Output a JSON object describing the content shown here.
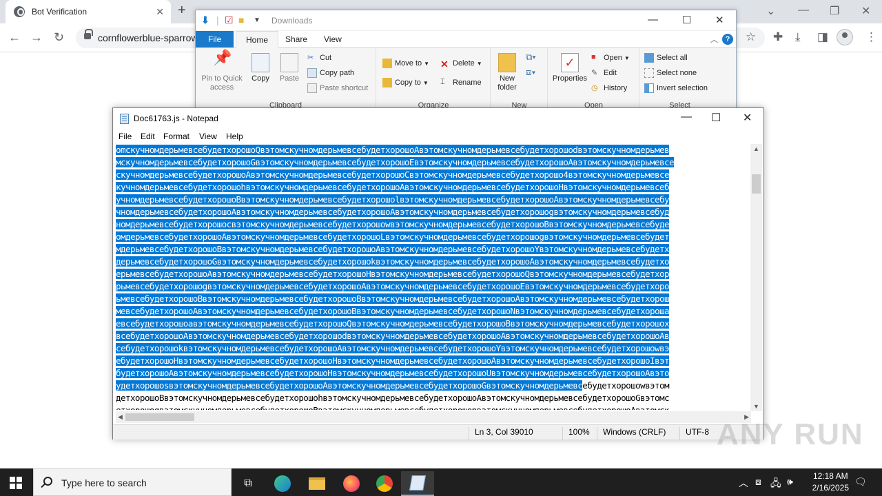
{
  "browser": {
    "tab_title": "Bot Verification",
    "url": "cornflowerblue-sparrow",
    "tab_close": "✕",
    "new_tab": "+"
  },
  "explorer": {
    "title": "Downloads",
    "tabs": [
      "File",
      "Home",
      "Share",
      "View"
    ],
    "clipboard": {
      "pin": "Pin to Quick access",
      "copy": "Copy",
      "paste": "Paste",
      "cut": "Cut",
      "copy_path": "Copy path",
      "paste_shortcut": "Paste shortcut",
      "label": "Clipboard"
    },
    "organize": {
      "move_to": "Move to",
      "copy_to": "Copy to",
      "delete": "Delete",
      "rename": "Rename",
      "label": "Organize"
    },
    "new": {
      "new_folder": "New folder",
      "label": "New"
    },
    "open": {
      "properties": "Properties",
      "open": "Open",
      "edit": "Edit",
      "history": "History",
      "label": "Open"
    },
    "select": {
      "select_all": "Select all",
      "select_none": "Select none",
      "invert": "Invert selection",
      "label": "Select"
    }
  },
  "notepad": {
    "title": "Doc61763.js - Notepad",
    "menu": [
      "File",
      "Edit",
      "Format",
      "View",
      "Help"
    ],
    "lines_selected": [
      "omскучномдерьмевсебудетхорошоQвэтомскучномдерьмевсебудетхорошоAвэтомскучномдерьмевсебудетхорошоdвэтомскучномдерьмев",
      "мскучномдерьмевсебудетхорошоGвэтомскучномдерьмевсебудетхорошоEвэтомскучномдерьмевсебудетхорошоAвэтомскучномдерьмевсе",
      "скучномдерьмевсебудетхорошоAвэтомскучномдерьмевсебудетхорошоCвэтомскучномдерьмевсебудетхорошо4вэтомскучномдерьмевсе",
      "кучномдерьмевсебудетхорошоhвэтомскучномдерьмевсебудетхорошоAвэтомскучномдерьмевсебудетхорошоHвэтомскучномдерьмевсеб",
      "учномдерьмевсебудетхорошоBвэтомскучномдерьмевсебудетхорошоlвэтомскучномдерьмевсебудетхорошоAвэтомскучномдерьмевсебу",
      "чномдерьмевсебудетхорошоAвэтомскучномдерьмевсебудетхорошоAвэтомскучномдерьмевсебудетхорошоgвэтомскучномдерьмевсебуд",
      "номдерьмевсебудетхорошоcвэтомскучномдерьмевсебудетхорошоwвэтомскучномдерьмевсебудетхорошоBвэтомскучномдерьмевсебуде",
      "омдерьмевсебудетхорошоAвэтомскучномдерьмевсебудетхорошоLвэтомскучномдерьмевсебудетхорошоgвэтомскучномдерьмевсебудет",
      "мдерьмевсебудетхорошоBвэтомскучномдерьмевсебудетхорошоAвэтомскучномдерьмевсебудетхорошоYвэтомскучномдерьмевсебудетх",
      "дерьмевсебудетхорошоGвэтомскучномдерьмевсебудетхорошоkвэтомскучномдерьмевсебудетхорошоAвэтомскучномдерьмевсебудетхо",
      "ерьмевсебудетхорошоAвэтомскучномдерьмевсебудетхорошоHвэтомскучномдерьмевсебудетхорошоQвэтомскучномдерьмевсебудетхор",
      "рьмевсебудетхорошоgвэтомскучномдерьмевсебудетхорошоAвэтомскучномдерьмевсебудетхорошоEвэтомскучномдерьмевсебудетхоро",
      "ьмевсебудетхорошоBвэтомскучномдерьмевсебудетхорошоBвэтомскучномдерьмевсебудетхорошоAвэтомскучномдерьмевсебудетхорош",
      "мевсебудетхорошоAвэтомскучномдерьмевсебудетхорошоBвэтомскучномдерьмевсебудетхорошоNвэтомскучномдерьмевсебудетхороша",
      "евсебудетхорошоaвэтомскучномдерьмевсебудетхорошоQвэтомскучномдерьмевсебудетхорошоBвэтомскучномдерьмевсебудетхорошоx",
      "всебудетхорошоAвэтомскучномдерьмевсебудетхорошоdвэтомскучномдерьмевсебудетхорошоAвэтомскучномдерьмевсебудетхорошоAв",
      "себудетхорошоkвэтомскучномдерьмевсебудетхорошоAвэтомскучномдерьмевсебудетхорошоYвэтомскучномдерьмевсебудетхорошоwвэ",
      "ебудетхорошоHвэтомскучномдерьмевсебудетхорошоHвэтомскучномдерьмевсебудетхорошоAвэтомскучномдерьмевсебудетхорошоIвэт",
      "будетхорошоAвэтомскучномдерьмевсебудетхорошоHвэтомскучномдерьмевсебудетхорошоUвэтомскучномдерьмевсебудетхорошоAвэто"
    ],
    "last_line_selected": "удетхорошоsвэтомскучномдерьмевсебудетхорошоAвэтомскучномдерьмевсебудетхорошоGвэтомскучномдерьмевс",
    "last_line_rest": "ебудетхорошоwвэтом",
    "lines_plain": [
      "детхорошоBвэтомскучномдерьмевсебудетхорошоhвэтомскучномдерьмевсебудетхорошоAвэтомскучномдерьмевсебудетхорошоGвэтомс",
      "етхорошоgвэтомскучномдерьмевсебудетхорошоBвэтомскучномдерьмевсебудетхорошоpвэтомскучномдерьмевсебудетхорошоAвэтомск"
    ],
    "status": {
      "position": "Ln 3, Col 39010",
      "zoom": "100%",
      "line_ending": "Windows (CRLF)",
      "encoding": "UTF-8"
    }
  },
  "watermark": "ANY RUN",
  "taskbar": {
    "search_placeholder": "Type here to search",
    "time": "12:18 AM",
    "date": "2/16/2025"
  }
}
